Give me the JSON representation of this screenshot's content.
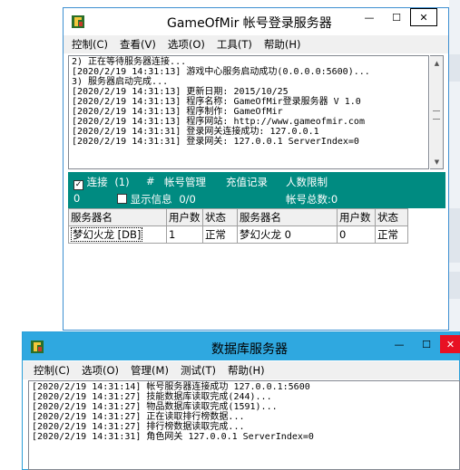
{
  "login_window": {
    "title": "GameOfMir 帐号登录服务器",
    "menu": [
      "控制(C)",
      "查看(V)",
      "选项(O)",
      "工具(T)",
      "帮助(H)"
    ],
    "log_lines": [
      "2) 正在等待服务器连接...",
      "[2020/2/19 14:31:13] 游戏中心服务启动成功(0.0.0.0:5600)...",
      "3) 服务器启动完成...",
      "[2020/2/19 14:31:13] 更新日期: 2015/10/25",
      "[2020/2/19 14:31:13] 程序名称: GameOfMir登录服务器 V 1.0",
      "[2020/2/19 14:31:13] 程序制作: GameOfMir",
      "[2020/2/19 14:31:13] 程序网站: http://www.gameofmir.com",
      "[2020/2/19 14:31:31] 登录网关连接成功: 127.0.0.1",
      "[2020/2/19 14:31:31] 登录网关: 127.0.0.1 ServerIndex=0"
    ],
    "status": {
      "connect_label": "连接",
      "connect_count": "(1)",
      "hash": "#",
      "account_mgmt": "帐号管理",
      "recharge": "充值记录",
      "user_limit": "人数限制",
      "zero": "0",
      "show_info_label": "显示信息",
      "ratio": "0/0",
      "account_total": "帐号总数:0"
    },
    "table": {
      "headers": [
        "服务器名",
        "用户数",
        "状态",
        "服务器名",
        "用户数",
        "状态"
      ],
      "row": [
        "梦幻火龙 [DB]",
        "1",
        "正常",
        "梦幻火龙 0",
        "0",
        "正常"
      ]
    }
  },
  "db_window": {
    "title": "数据库服务器",
    "menu": [
      "控制(C)",
      "选项(O)",
      "管理(M)",
      "测试(T)",
      "帮助(H)"
    ],
    "log_lines": [
      "[2020/2/19 14:31:14] 帐号服务器连接成功 127.0.0.1:5600",
      "[2020/2/19 14:31:27] 技能数据库读取完成(244)...",
      "[2020/2/19 14:31:27] 物品数据库读取完成(1591)...",
      "[2020/2/19 14:31:27] 正在读取排行榜数据...",
      "[2020/2/19 14:31:27] 排行榜数据读取完成...",
      "[2020/2/19 14:31:31] 角色网关 127.0.0.1 ServerIndex=0"
    ]
  },
  "window_buttons": {
    "minimize": "—",
    "maximize": "☐",
    "close": "✕"
  },
  "colors": {
    "teal": "#008b81",
    "close": "#e81123",
    "title_border": "#3d8fd1"
  }
}
